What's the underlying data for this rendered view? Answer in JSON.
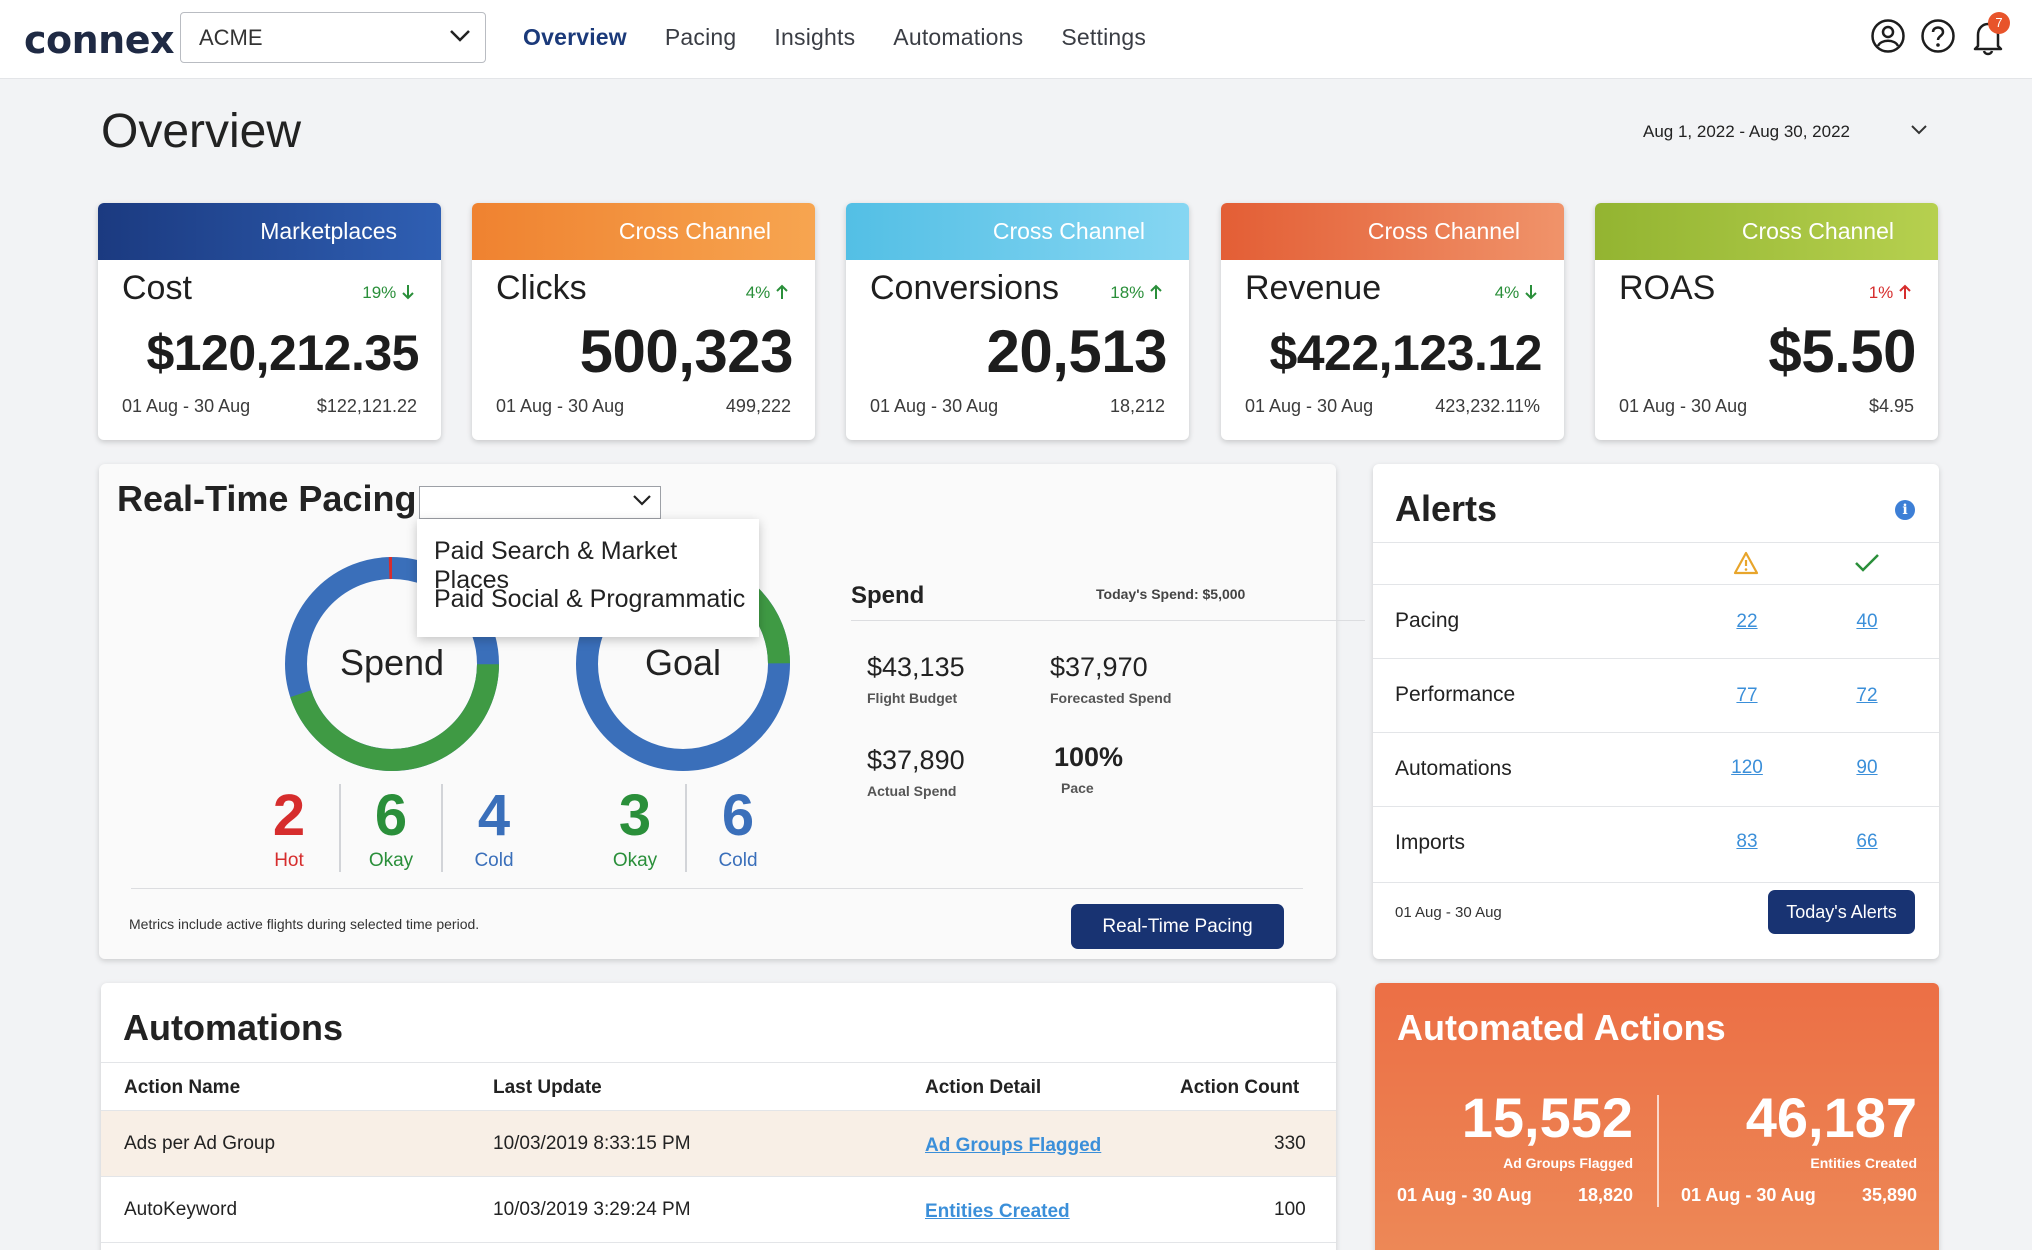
{
  "header": {
    "logo": "connex",
    "account_select": "ACME",
    "nav": [
      "Overview",
      "Pacing",
      "Insights",
      "Automations",
      "Settings"
    ],
    "notification_count": "7"
  },
  "page": {
    "title": "Overview",
    "date_range": "Aug 1, 2022 - Aug 30, 2022"
  },
  "kpis": [
    {
      "category": "Marketplaces",
      "label": "Cost",
      "change": "19%",
      "direction": "down",
      "value": "$120,212.35",
      "period": "01 Aug - 30 Aug",
      "previous": "$122,121.22",
      "color_from": "#1b3a80",
      "color_to": "#2f5fb3"
    },
    {
      "category": "Cross Channel",
      "label": "Clicks",
      "change": "4%",
      "direction": "up",
      "value": "500,323",
      "period": "01 Aug - 30 Aug",
      "previous": "499,222",
      "color_from": "#ef8230",
      "color_to": "#f7a550"
    },
    {
      "category": "Cross Channel",
      "label": "Conversions",
      "change": "18%",
      "direction": "up",
      "value": "20,513",
      "period": "01 Aug - 30 Aug",
      "previous": "18,212",
      "color_from": "#53bfe5",
      "color_to": "#86d6f2"
    },
    {
      "category": "Cross Channel",
      "label": "Revenue",
      "change": "4%",
      "direction": "down",
      "value": "$422,123.12",
      "period": "01 Aug - 30 Aug",
      "previous": "423,232.11%",
      "color_from": "#e35e35",
      "color_to": "#f0936a"
    },
    {
      "category": "Cross Channel",
      "label": "ROAS",
      "change": "1%",
      "direction": "up",
      "value": "$5.50",
      "period": "01 Aug - 30 Aug",
      "previous": "$4.95",
      "color_from": "#93b431",
      "color_to": "#b6d04f"
    }
  ],
  "pacing": {
    "title": "Real-Time Pacing",
    "dropdown_options": [
      "Paid Search  & Market Places",
      "Paid Social & Programmatic"
    ],
    "spend_donut": {
      "label": "Spend",
      "counts": [
        {
          "num": "2",
          "label": "Hot"
        },
        {
          "num": "6",
          "label": "Okay"
        },
        {
          "num": "4",
          "label": "Cold"
        }
      ]
    },
    "goal_donut": {
      "label": "Goal",
      "counts": [
        {
          "num": "3",
          "label": "Okay"
        },
        {
          "num": "6",
          "label": "Cold"
        }
      ]
    },
    "spend_title": "Spend",
    "todays_spend": "Today's Spend: $5,000",
    "flight_budget": "$43,135",
    "flight_budget_label": "Flight Budget",
    "forecasted_spend": "$37,970",
    "forecasted_spend_label": "Forecasted Spend",
    "actual_spend": "$37,890",
    "actual_spend_label": "Actual Spend",
    "pace": "100%",
    "pace_label": "Pace",
    "note": "Metrics include active flights during selected time period.",
    "button": "Real-Time Pacing"
  },
  "alerts": {
    "title": "Alerts",
    "rows": [
      {
        "name": "Pacing",
        "warn": "22",
        "ok": "40"
      },
      {
        "name": "Performance",
        "warn": "77",
        "ok": "72"
      },
      {
        "name": "Automations",
        "warn": "120",
        "ok": "90"
      },
      {
        "name": "Imports",
        "warn": "83",
        "ok": "66"
      }
    ],
    "period": "01 Aug - 30 Aug",
    "button": "Today's Alerts"
  },
  "automations": {
    "title": "Automations",
    "columns": [
      "Action Name",
      "Last Update",
      "Action Detail",
      "Action Count"
    ],
    "rows": [
      {
        "name": "Ads per Ad Group",
        "updated": "10/03/2019 8:33:15 PM",
        "detail": "Ad Groups Flagged",
        "count": "330"
      },
      {
        "name": "AutoKeyword",
        "updated": "10/03/2019 3:29:24 PM",
        "detail": "Entities Created",
        "count": "100"
      }
    ]
  },
  "automated_actions": {
    "title": "Automated Actions",
    "left": {
      "value": "15,552",
      "label": "Ad Groups Flagged",
      "period": "01 Aug - 30 Aug",
      "previous": "18,820"
    },
    "right": {
      "value": "46,187",
      "label": "Entities Created",
      "period": "01 Aug - 30 Aug",
      "previous": "35,890"
    }
  },
  "colors": {
    "navy": "#183372",
    "hot": "#d62d2d",
    "okay": "#2a8f3a",
    "cold": "#3a6fba",
    "link": "#3b8fd9",
    "warning": "#e8a52b"
  }
}
